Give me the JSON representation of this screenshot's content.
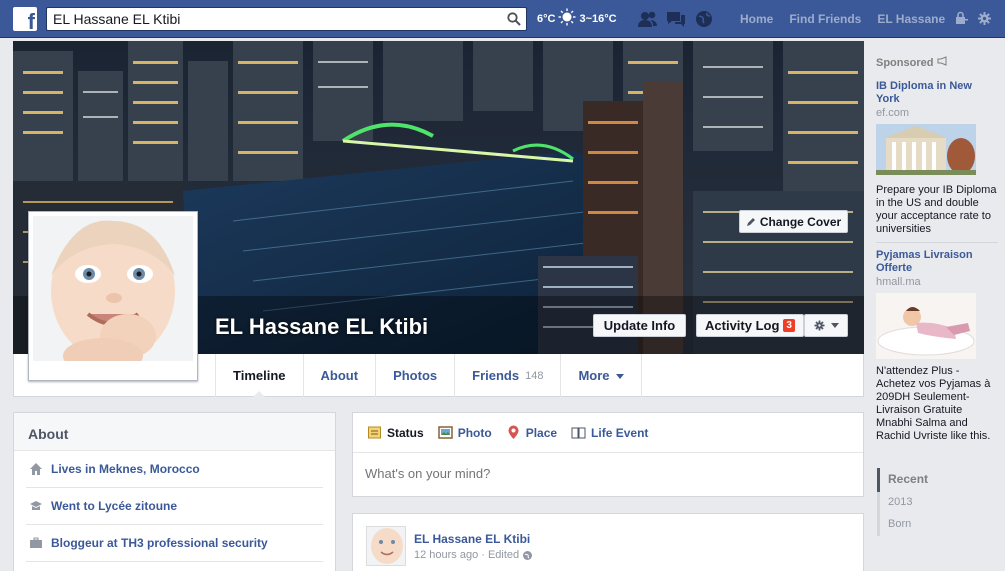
{
  "topbar": {
    "search_value": "EL Hassane EL Ktibi",
    "weather": {
      "now": "6°C",
      "range": "3~16°C"
    },
    "nav": [
      "Home",
      "Find Friends",
      "EL Hassane"
    ]
  },
  "cover": {
    "change_cover": "Change Cover",
    "name": "EL Hassane EL Ktibi",
    "update_info": "Update Info",
    "activity_log": "Activity Log",
    "activity_count": "3"
  },
  "tabs": [
    {
      "label": "Timeline"
    },
    {
      "label": "About"
    },
    {
      "label": "Photos"
    },
    {
      "label": "Friends",
      "count": "148"
    },
    {
      "label": "More"
    }
  ],
  "about": {
    "title": "About",
    "items": [
      {
        "prefix": "Lives in ",
        "link": "Meknes, Morocco"
      },
      {
        "prefix": "Went to ",
        "link": "Lycée zitoune"
      },
      {
        "prefix": "Bloggeur at ",
        "link": "TH3 professional security"
      }
    ]
  },
  "composer": {
    "tabs": [
      "Status",
      "Photo",
      "Place",
      "Life Event"
    ],
    "placeholder": "What's on your mind?"
  },
  "story": {
    "author": "EL Hassane EL Ktibi",
    "time": "12 hours ago",
    "edited": "· Edited"
  },
  "sidebar": {
    "sponsored": "Sponsored",
    "ads": [
      {
        "title": "IB Diploma in New York",
        "domain": "ef.com",
        "text": "Prepare your IB Diploma in the US and double your acceptance rate to universities"
      },
      {
        "title": "Pyjamas Livraison Offerte",
        "domain": "hmall.ma",
        "text": "N'attendez Plus - Achetez vos Pyjamas à 209DH Seulement- Livraison Gratuite Mnabhi Salma and Rachid Uvriste like this."
      }
    ],
    "years": [
      "Recent",
      "2013",
      "Born"
    ]
  },
  "colors": {
    "brand": "#3b5998",
    "badge": "#f03d25"
  }
}
